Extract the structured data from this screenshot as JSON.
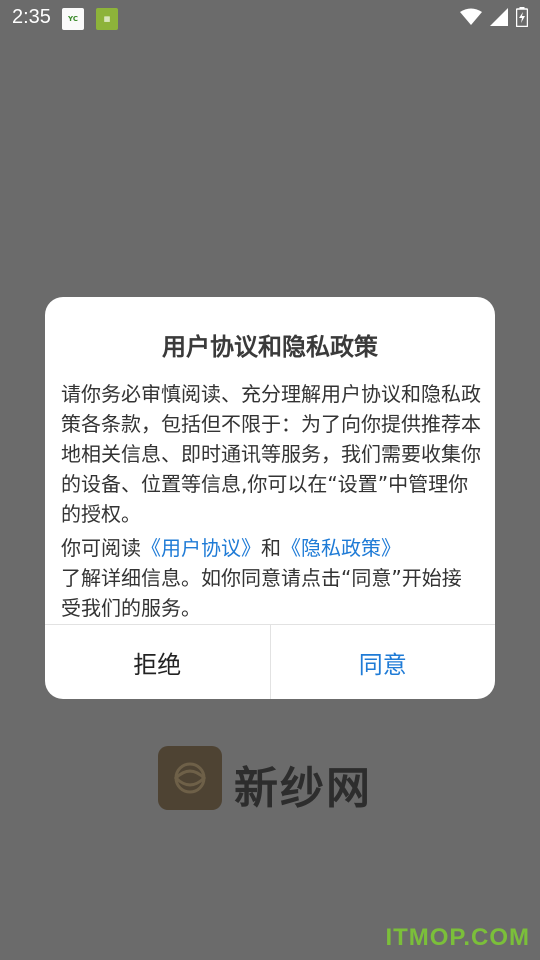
{
  "status_bar": {
    "time": "2:35",
    "notification_icons": [
      "app-notification-icon",
      "app-notification-icon"
    ],
    "icons": [
      "wifi-icon",
      "cellular-signal-icon",
      "battery-charging-icon"
    ]
  },
  "dialog": {
    "title": "用户协议和隐私政策",
    "paragraph1": "请你务必审慎阅读、充分理解用户协议和隐私政策各条款，包括但不限于：为了向你提供推荐本地相关信息、即时通讯等服务，我们需要收集你的设备、位置等信息,你可以在“设置”中管理你的授权。",
    "paragraph2_prefix": "你可阅读",
    "user_agreement_link": "《用户协议》",
    "connector": "和",
    "privacy_policy_link": "《隐私政策》",
    "paragraph3": "了解详细信息。如你同意请点击“同意”开始接受我们的服务。",
    "reject_label": "拒绝",
    "agree_label": "同意"
  },
  "background": {
    "brand_name": "新纱网",
    "watermark": "ITMOP.COM"
  },
  "colors": {
    "overlay": "#6b6b6b",
    "link": "#1f7bd6",
    "dialog_bg": "#ffffff",
    "watermark": "#7bbf3a"
  }
}
